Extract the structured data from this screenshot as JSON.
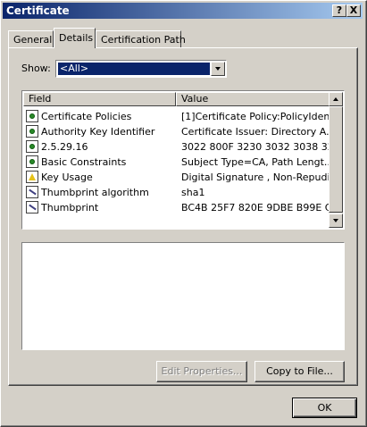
{
  "window": {
    "title": "Certificate",
    "help_button": "?",
    "close_button": "X"
  },
  "tabs": [
    {
      "label": "General",
      "active": false
    },
    {
      "label": "Details",
      "active": true
    },
    {
      "label": "Certification Path",
      "active": false
    }
  ],
  "show": {
    "label": "Show:",
    "selected": "<All>"
  },
  "list": {
    "columns": [
      "Field",
      "Value"
    ],
    "rows": [
      {
        "icon": "certificate-field-icon",
        "field": "Certificate Policies",
        "value": "[1]Certificate Policy:PolicyIden..."
      },
      {
        "icon": "certificate-field-icon",
        "field": "Authority Key Identifier",
        "value": "Certificate Issuer: Directory A..."
      },
      {
        "icon": "certificate-field-icon",
        "field": "2.5.29.16",
        "value": "3022 800F 3230 3032 3038 32..."
      },
      {
        "icon": "certificate-field-icon",
        "field": "Basic Constraints",
        "value": "Subject Type=CA, Path Lengt..."
      },
      {
        "icon": "warning-field-icon",
        "field": "Key Usage",
        "value": "Digital Signature , Non-Repudi..."
      },
      {
        "icon": "thumbprint-property-icon",
        "field": "Thumbprint algorithm",
        "value": "sha1"
      },
      {
        "icon": "thumbprint-property-icon",
        "field": "Thumbprint",
        "value": "BC4B 25F7 820E 9DBE B99E C..."
      }
    ]
  },
  "buttons": {
    "edit_properties": "Edit Properties...",
    "copy_to_file": "Copy to File...",
    "ok": "OK"
  },
  "colors": {
    "title_bar_start": "#0a246a",
    "title_bar_end": "#a6caf0",
    "selection": "#0a246a",
    "face": "#d4d0c8"
  }
}
